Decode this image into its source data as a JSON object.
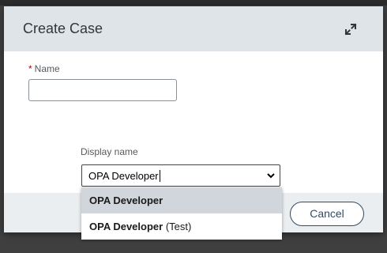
{
  "dialog": {
    "title": "Create Case",
    "icons": {
      "expand": "expand-icon"
    }
  },
  "form": {
    "name": {
      "label": "Name",
      "required_marker": "*",
      "value": ""
    },
    "display_name": {
      "label": "Display name",
      "value": "OPA Developer"
    }
  },
  "dropdown": {
    "options": [
      {
        "strong": "OPA Developer",
        "suffix": "",
        "selected": true
      },
      {
        "strong": "OPA Developer",
        "suffix": " (Test)",
        "selected": false
      }
    ]
  },
  "footer": {
    "cancel_label": "Cancel"
  },
  "colors": {
    "header_bg": "#dfe4e8",
    "footer_bg": "#ebeef1",
    "selected_option_bg": "#d0d6dc",
    "button_border": "#354a5f",
    "required": "#bb0000"
  }
}
